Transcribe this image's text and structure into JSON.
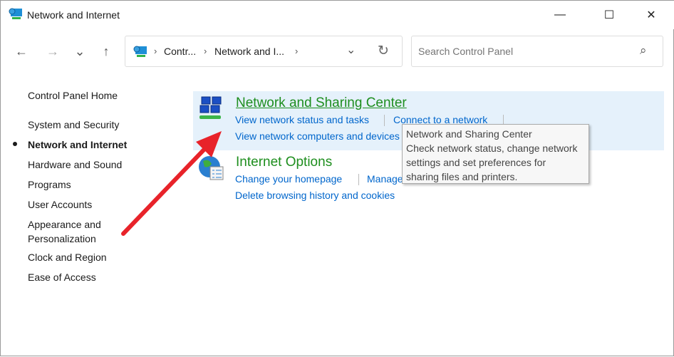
{
  "window": {
    "title": "Network and Internet",
    "minimize": "—",
    "maximize": "☐",
    "close": "✕"
  },
  "nav": {
    "back": "←",
    "forward": "→",
    "recent": "⌄",
    "up": "↑"
  },
  "address": {
    "crumbs": [
      "Contr...",
      "Network and I..."
    ],
    "separator": "›",
    "dropdown": "⌄",
    "refresh": "↻"
  },
  "search": {
    "placeholder": "Search Control Panel",
    "icon": "⌕"
  },
  "sidebar": {
    "home": "Control Panel Home",
    "items": [
      "System and Security",
      "Network and Internet",
      "Hardware and Sound",
      "Programs",
      "User Accounts",
      "Appearance and",
      "Personalization",
      "Clock and Region",
      "Ease of Access"
    ],
    "active": "Network and Internet"
  },
  "categories": [
    {
      "title": "Network and Sharing Center",
      "links": [
        "View network status and tasks",
        "Connect to a network",
        "View network computers and devices"
      ]
    },
    {
      "title": "Internet Options",
      "links": [
        "Change your homepage",
        "Manage browser add-ons",
        "Delete browsing history and cookies"
      ]
    }
  ],
  "tooltip": {
    "title": "Network and Sharing Center",
    "lines": [
      "Check network status, change network",
      "settings and set preferences for",
      "sharing files and printers."
    ]
  },
  "annotation": {
    "arrow_color": "#e8232a"
  }
}
